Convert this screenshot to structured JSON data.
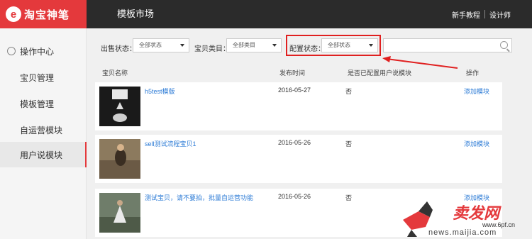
{
  "header": {
    "logo_mark": "e",
    "logo_text": "淘宝神笔",
    "title": "模板市场",
    "links": [
      "新手教程",
      "设计师"
    ]
  },
  "sidebar": {
    "items": [
      {
        "label": "操作中心",
        "icon": "circle-icon",
        "active": false
      },
      {
        "label": "宝贝管理",
        "active": false
      },
      {
        "label": "模板管理",
        "active": false
      },
      {
        "label": "自运营模块",
        "active": false
      },
      {
        "label": "用户说模块",
        "active": true
      }
    ]
  },
  "filters": {
    "sale_status_label": "出售状态：",
    "sale_status_value": "全部状态",
    "category_label": "宝贝类目：",
    "category_value": "全部类目",
    "config_status_label": "配置状态：",
    "config_status_value": "全部状态",
    "search_placeholder": ""
  },
  "table": {
    "columns": [
      "宝贝名称",
      "发布时间",
      "是否已配置用户说模块",
      "操作"
    ],
    "rows": [
      {
        "title": "h5test模版",
        "date": "2016-05-27",
        "configured": "否",
        "action": "添加模块"
      },
      {
        "title": "sell测试流程宝贝1",
        "date": "2016-05-26",
        "configured": "否",
        "action": "添加模块"
      },
      {
        "title": "测试宝贝，请不要拍，批量自运营功能",
        "date": "2016-05-26",
        "configured": "否",
        "action": "添加模块"
      }
    ]
  },
  "watermark": {
    "brand": "卖发网",
    "site": "www.6pf.cn",
    "news": "news.maijia.com"
  },
  "colors": {
    "brand_red": "#e4393c",
    "header_bg": "#2b2b2b",
    "link_blue": "#2c7bd6",
    "highlight": "#e02020"
  }
}
